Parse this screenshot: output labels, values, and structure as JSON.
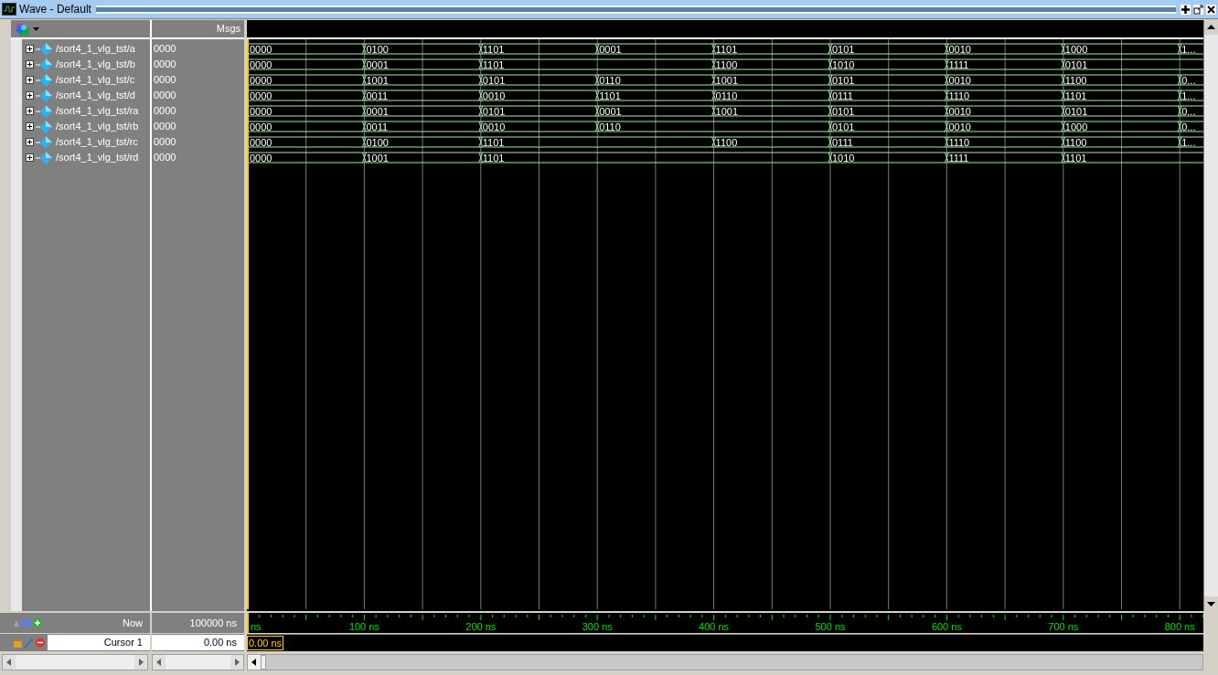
{
  "window": {
    "title": "Wave - Default"
  },
  "columns": {
    "msgs": "Msgs"
  },
  "signals": [
    {
      "name": "/sort4_1_vlg_tst/a",
      "msg": "0000",
      "expanded": false,
      "slots": [
        {
          "kind": "change",
          "value": "0000"
        },
        {
          "kind": "change",
          "value": "0100"
        },
        {
          "kind": "change",
          "value": "1101"
        },
        {
          "kind": "change",
          "value": "0001"
        },
        {
          "kind": "change",
          "value": "1101"
        },
        {
          "kind": "change",
          "value": "0101"
        },
        {
          "kind": "change",
          "value": "0010"
        },
        {
          "kind": "change",
          "value": "1000"
        },
        {
          "kind": "change",
          "value": "1..."
        }
      ]
    },
    {
      "name": "/sort4_1_vlg_tst/b",
      "msg": "0000",
      "expanded": false,
      "slots": [
        {
          "kind": "change",
          "value": "0000"
        },
        {
          "kind": "change",
          "value": "0001"
        },
        {
          "kind": "change",
          "value": "1101"
        },
        {
          "kind": "hold"
        },
        {
          "kind": "change",
          "value": "1100"
        },
        {
          "kind": "change",
          "value": "1010"
        },
        {
          "kind": "change",
          "value": "1111"
        },
        {
          "kind": "change",
          "value": "0101"
        },
        {
          "kind": "hold"
        }
      ]
    },
    {
      "name": "/sort4_1_vlg_tst/c",
      "msg": "0000",
      "expanded": false,
      "slots": [
        {
          "kind": "change",
          "value": "0000"
        },
        {
          "kind": "change",
          "value": "1001"
        },
        {
          "kind": "change",
          "value": "0101"
        },
        {
          "kind": "change",
          "value": "0110"
        },
        {
          "kind": "change",
          "value": "1001"
        },
        {
          "kind": "change",
          "value": "0101"
        },
        {
          "kind": "change",
          "value": "0010"
        },
        {
          "kind": "change",
          "value": "1100"
        },
        {
          "kind": "change",
          "value": "0..."
        }
      ]
    },
    {
      "name": "/sort4_1_vlg_tst/d",
      "msg": "0000",
      "expanded": false,
      "slots": [
        {
          "kind": "change",
          "value": "0000"
        },
        {
          "kind": "change",
          "value": "0011"
        },
        {
          "kind": "change",
          "value": "0010"
        },
        {
          "kind": "change",
          "value": "1101"
        },
        {
          "kind": "change",
          "value": "0110"
        },
        {
          "kind": "change",
          "value": "0111"
        },
        {
          "kind": "change",
          "value": "1110"
        },
        {
          "kind": "change",
          "value": "1101"
        },
        {
          "kind": "change",
          "value": "1..."
        }
      ]
    },
    {
      "name": "/sort4_1_vlg_tst/ra",
      "msg": "0000",
      "expanded": false,
      "slots": [
        {
          "kind": "change",
          "value": "0000"
        },
        {
          "kind": "change",
          "value": "0001"
        },
        {
          "kind": "change",
          "value": "0101"
        },
        {
          "kind": "change",
          "value": "0001"
        },
        {
          "kind": "change",
          "value": "1001"
        },
        {
          "kind": "change",
          "value": "0101"
        },
        {
          "kind": "change",
          "value": "0010"
        },
        {
          "kind": "change",
          "value": "0101"
        },
        {
          "kind": "change",
          "value": "0..."
        }
      ]
    },
    {
      "name": "/sort4_1_vlg_tst/rb",
      "msg": "0000",
      "expanded": false,
      "slots": [
        {
          "kind": "change",
          "value": "0000"
        },
        {
          "kind": "change",
          "value": "0011"
        },
        {
          "kind": "change",
          "value": "0010"
        },
        {
          "kind": "change",
          "value": "0110"
        },
        {
          "kind": "hold"
        },
        {
          "kind": "change",
          "value": "0101"
        },
        {
          "kind": "change",
          "value": "0010"
        },
        {
          "kind": "change",
          "value": "1000"
        },
        {
          "kind": "change",
          "value": "0..."
        }
      ]
    },
    {
      "name": "/sort4_1_vlg_tst/rc",
      "msg": "0000",
      "expanded": false,
      "slots": [
        {
          "kind": "change",
          "value": "0000"
        },
        {
          "kind": "change",
          "value": "0100"
        },
        {
          "kind": "change",
          "value": "1101"
        },
        {
          "kind": "hold"
        },
        {
          "kind": "change",
          "value": "1100"
        },
        {
          "kind": "change",
          "value": "0111"
        },
        {
          "kind": "change",
          "value": "1110"
        },
        {
          "kind": "change",
          "value": "1100"
        },
        {
          "kind": "change",
          "value": "1..."
        }
      ]
    },
    {
      "name": "/sort4_1_vlg_tst/rd",
      "msg": "0000",
      "expanded": false,
      "slots": [
        {
          "kind": "change",
          "value": "0000"
        },
        {
          "kind": "change",
          "value": "1001"
        },
        {
          "kind": "change",
          "value": "1101"
        },
        {
          "kind": "hold"
        },
        {
          "kind": "hold"
        },
        {
          "kind": "change",
          "value": "1010"
        },
        {
          "kind": "change",
          "value": "1111"
        },
        {
          "kind": "change",
          "value": "1101"
        },
        {
          "kind": "hold"
        }
      ]
    }
  ],
  "ruler": {
    "labels": [
      "ns",
      "100 ns",
      "200 ns",
      "300 ns",
      "400 ns",
      "500 ns",
      "600 ns",
      "700 ns",
      "800 ns"
    ]
  },
  "now": {
    "label": "Now",
    "value": "100000 ns"
  },
  "cursor": {
    "label": "Cursor 1",
    "value": "0.00 ns",
    "marker": "0.00 ns"
  }
}
